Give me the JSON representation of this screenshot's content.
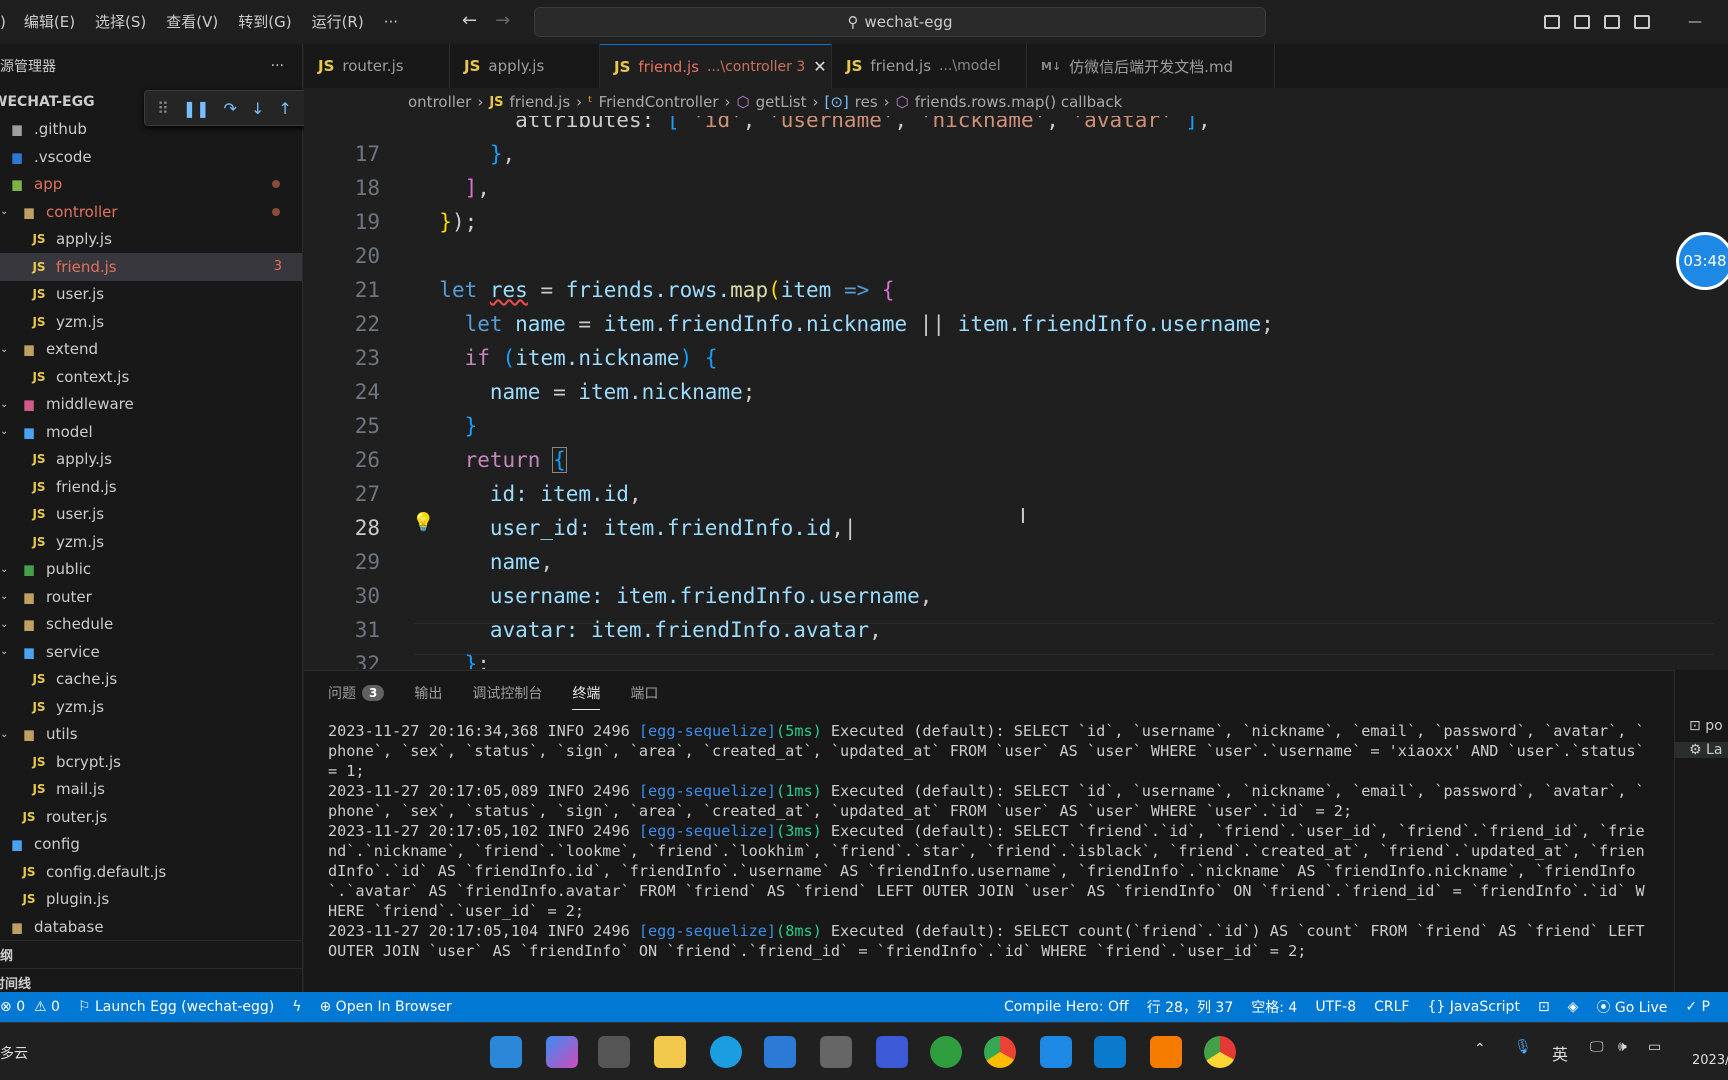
{
  "menu": [
    "编辑(E)",
    "选择(S)",
    "查看(V)",
    "转到(G)",
    "运行(R)",
    "···"
  ],
  "menu_prefix": ")",
  "search": "wechat-egg",
  "sidebar": {
    "title": "资源管理器",
    "more": "···",
    "root": "WECHAT-EGG",
    "items": [
      {
        "label": ".github",
        "depth": 0
      },
      {
        "label": ".vscode",
        "depth": 0
      },
      {
        "label": "app",
        "depth": 0,
        "color": "#e2725b"
      },
      {
        "label": "controller",
        "depth": 1,
        "color": "#e2725b"
      },
      {
        "label": "apply.js",
        "depth": 2,
        "js": true
      },
      {
        "label": "friend.js",
        "depth": 2,
        "js": true,
        "color": "#e2725b",
        "badge": "3"
      },
      {
        "label": "user.js",
        "depth": 2,
        "js": true
      },
      {
        "label": "yzm.js",
        "depth": 2,
        "js": true
      },
      {
        "label": "extend",
        "depth": 1
      },
      {
        "label": "context.js",
        "depth": 2,
        "js": true
      },
      {
        "label": "middleware",
        "depth": 1
      },
      {
        "label": "model",
        "depth": 1
      },
      {
        "label": "apply.js",
        "depth": 2,
        "js": true
      },
      {
        "label": "friend.js",
        "depth": 2,
        "js": true
      },
      {
        "label": "user.js",
        "depth": 2,
        "js": true
      },
      {
        "label": "yzm.js",
        "depth": 2,
        "js": true
      },
      {
        "label": "public",
        "depth": 1
      },
      {
        "label": "router",
        "depth": 1
      },
      {
        "label": "schedule",
        "depth": 1
      },
      {
        "label": "service",
        "depth": 1
      },
      {
        "label": "cache.js",
        "depth": 2,
        "js": true
      },
      {
        "label": "yzm.js",
        "depth": 2,
        "js": true
      },
      {
        "label": "utils",
        "depth": 1
      },
      {
        "label": "bcrypt.js",
        "depth": 2,
        "js": true
      },
      {
        "label": "mail.js",
        "depth": 2,
        "js": true
      },
      {
        "label": "router.js",
        "depth": 1,
        "js": true
      },
      {
        "label": "config",
        "depth": 0
      },
      {
        "label": "config.default.js",
        "depth": 1,
        "js": true
      },
      {
        "label": "plugin.js",
        "depth": 1,
        "js": true
      },
      {
        "label": "database",
        "depth": 0
      }
    ],
    "outline": "纲",
    "timeline": "时间线"
  },
  "tabs": [
    {
      "label": "router.js",
      "dim": ""
    },
    {
      "label": "apply.js",
      "dim": ""
    },
    {
      "label": "friend.js",
      "dim": "...\\controller 3",
      "active": true
    },
    {
      "label": "friend.js",
      "dim": "...\\model"
    },
    {
      "label": "仿微信后端开发文档.md",
      "dim": ""
    }
  ],
  "breadcrumb": [
    "ontroller",
    "friend.js",
    "FriendController",
    "getList",
    "res",
    "friends.rows.map() callback"
  ],
  "editor": {
    "line_numbers": [
      "17",
      "18",
      "19",
      "20",
      "21",
      "22",
      "23",
      "24",
      "25",
      "26",
      "27",
      "28",
      "29",
      "30",
      "31",
      "32"
    ],
    "current_line": "28"
  },
  "panel": {
    "tabs": [
      "问题",
      "输出",
      "调试控制台",
      "终端",
      "端口"
    ],
    "problems_count": "3",
    "active": "终端",
    "log": [
      {
        "ts": "2023-11-27 20:16:34,368 INFO 2496 ",
        "tag": "[egg-sequelize]",
        "ms": "(5ms)",
        "rest": " Executed (default): SELECT `id`, `username`, `nickname`, `email`, `password`, `avatar`, `phone`, `sex`, `status`, `sign`, `area`, `created_at`, `updated_at` FROM `user` AS `user` WHERE `user`.`username` = 'xiaoxx' AND `user`.`status` = 1;"
      },
      {
        "ts": "2023-11-27 20:17:05,089 INFO 2496 ",
        "tag": "[egg-sequelize]",
        "ms": "(1ms)",
        "rest": " Executed (default): SELECT `id`, `username`, `nickname`, `email`, `password`, `avatar`, `phone`, `sex`, `status`, `sign`, `area`, `created_at`, `updated_at` FROM `user` AS `user` WHERE `user`.`id` = 2;"
      },
      {
        "ts": "2023-11-27 20:17:05,102 INFO 2496 ",
        "tag": "[egg-sequelize]",
        "ms": "(3ms)",
        "rest": " Executed (default): SELECT `friend`.`id`, `friend`.`user_id`, `friend`.`friend_id`, `friend`.`nickname`, `friend`.`lookme`, `friend`.`lookhim`, `friend`.`star`, `friend`.`isblack`, `friend`.`created_at`, `friend`.`updated_at`, `friendInfo`.`id` AS `friendInfo.id`, `friendInfo`.`username` AS `friendInfo.username`, `friendInfo`.`nickname` AS `friendInfo.nickname`, `friendInfo`.`avatar` AS `friendInfo.avatar` FROM `friend` AS `friend` LEFT OUTER JOIN `user` AS `friendInfo` ON `friend`.`friend_id` = `friendInfo`.`id` WHERE `friend`.`user_id` = 2;"
      },
      {
        "ts": "2023-11-27 20:17:05,104 INFO 2496 ",
        "tag": "[egg-sequelize]",
        "ms": "(8ms)",
        "rest": " Executed (default): SELECT count(`friend`.`id`) AS `count` FROM `friend` AS `friend` LEFT OUTER JOIN `user` AS `friendInfo` ON `friend`.`friend_id` = `friendInfo`.`id` WHERE `friend`.`user_id` = 2;"
      }
    ],
    "side": [
      "po",
      "La"
    ]
  },
  "status": {
    "errors": "0",
    "warnings": "0",
    "launch": "Launch Egg (wechat-egg)",
    "open": "Open In Browser",
    "compile": "Compile Hero: Off",
    "position": "行 28，列 37",
    "spaces": "空格: 4",
    "encoding": "UTF-8",
    "eol": "CRLF",
    "language": "JavaScript",
    "golive": "Go Live",
    "prettier": "P"
  },
  "taskbar": {
    "weather": "多云",
    "ime": "英",
    "date": "2023/"
  },
  "clock": "03:48"
}
